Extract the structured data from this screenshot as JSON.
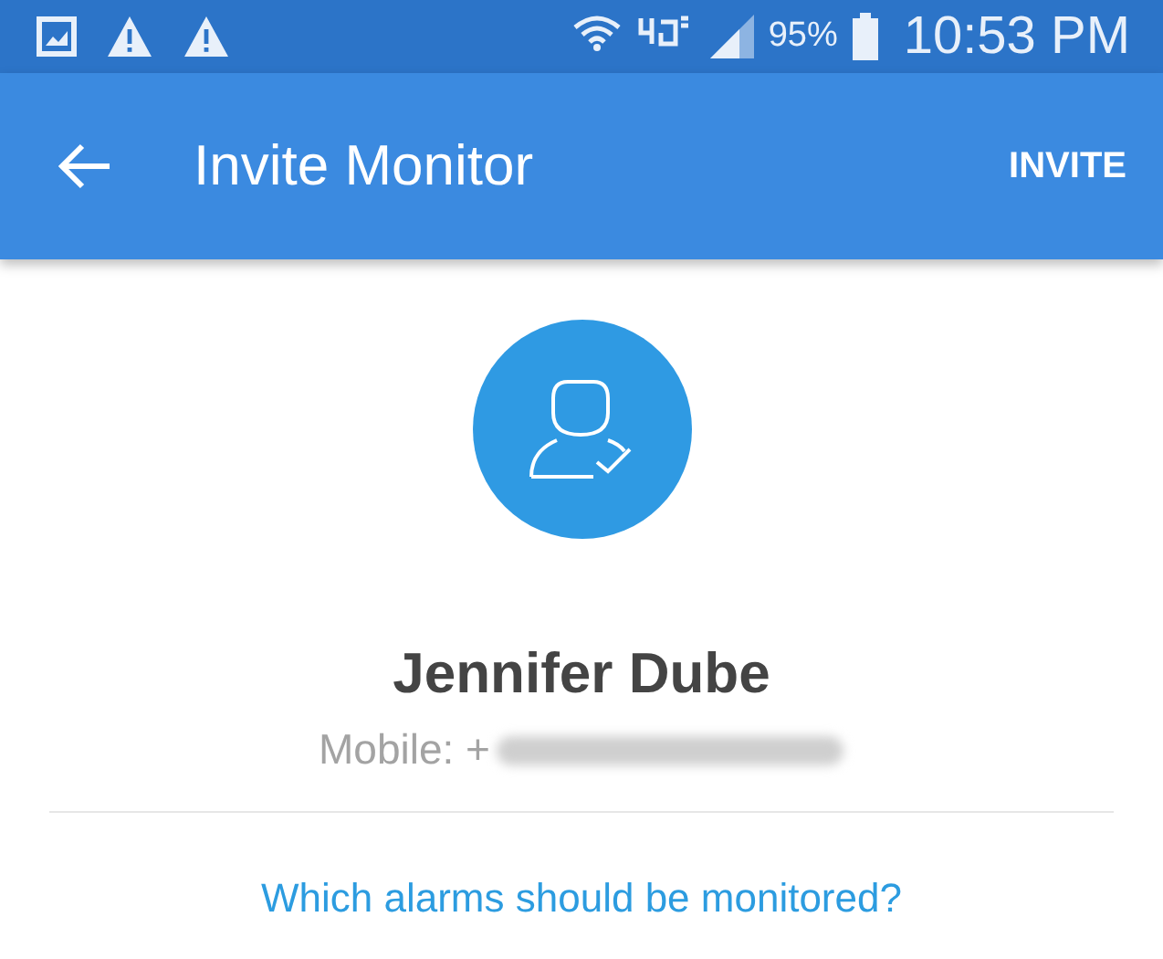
{
  "status_bar": {
    "battery": "95%",
    "time": "10:53 PM"
  },
  "app_bar": {
    "title": "Invite Monitor",
    "action": "INVITE"
  },
  "contact": {
    "name": "Jennifer Dube",
    "phone_label": "Mobile: +"
  },
  "question": "Which alarms should be monitored?"
}
